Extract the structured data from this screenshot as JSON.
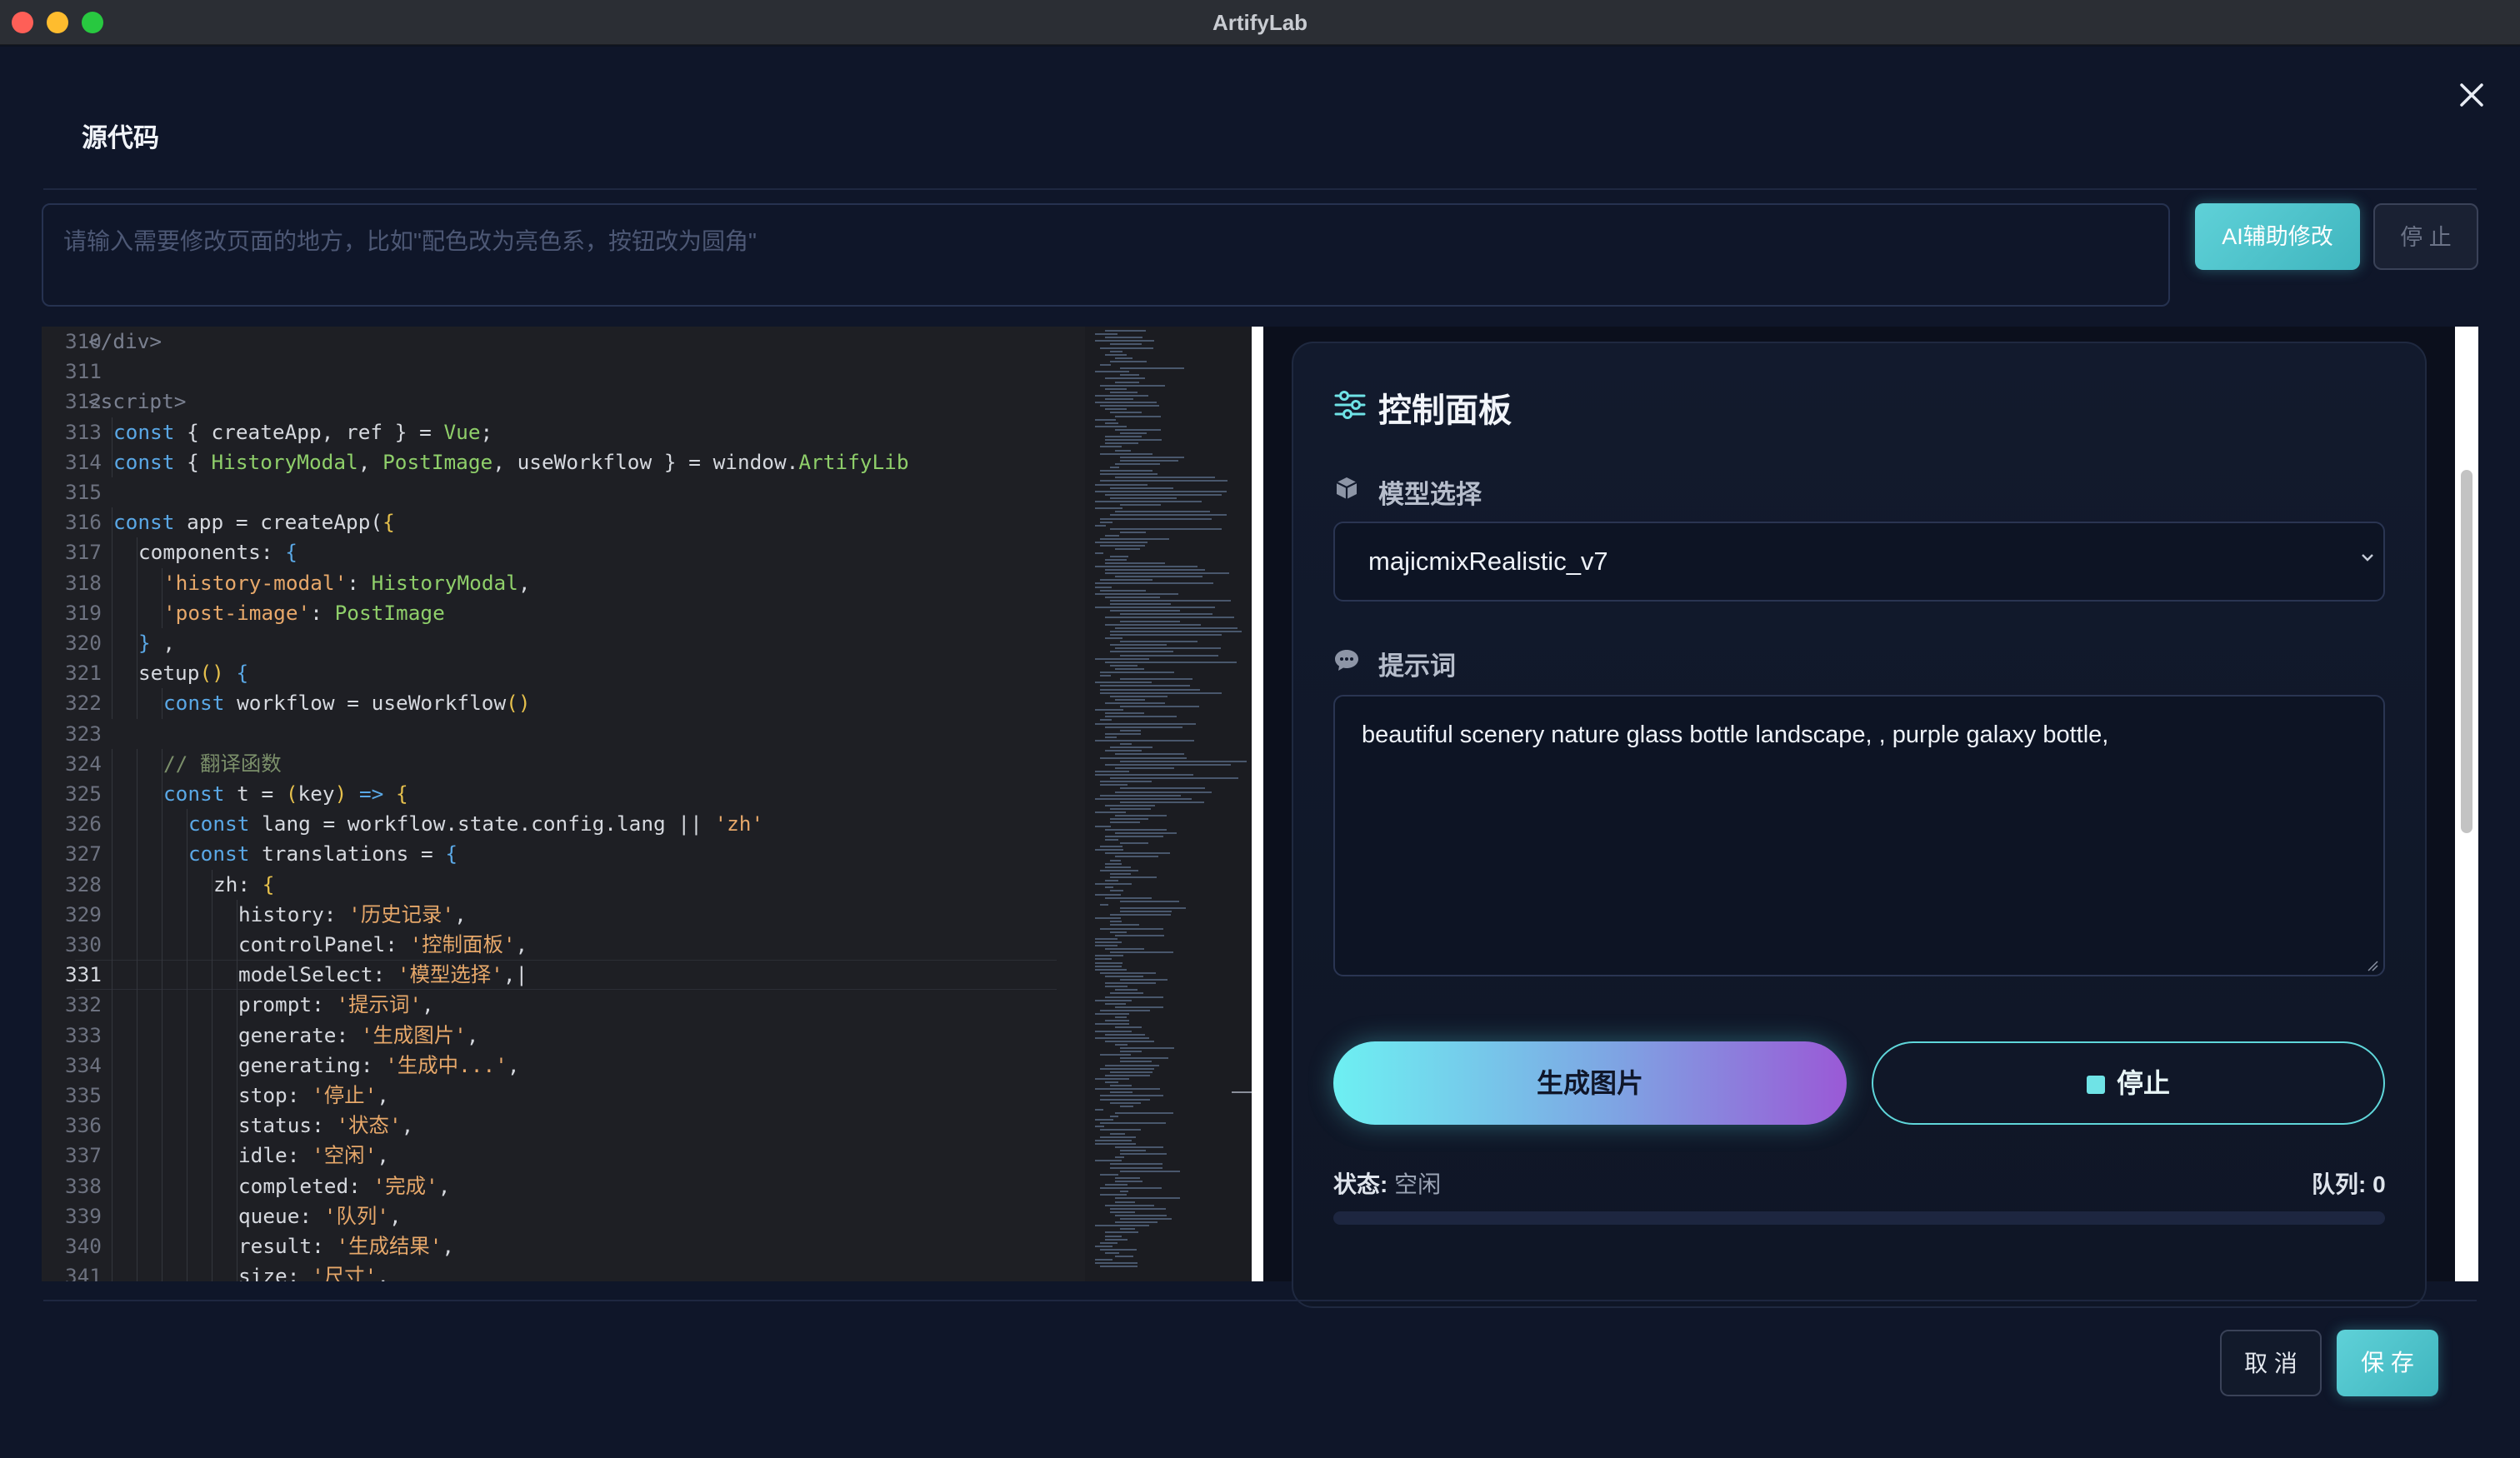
{
  "window": {
    "title": "ArtifyLab"
  },
  "modal": {
    "title": "源代码",
    "ai_input_placeholder": "请输入需要修改页面的地方，比如\"配色改为亮色系，按钮改为圆角\"",
    "ai_button": "AI辅助修改",
    "stop_button": "停 止",
    "cancel_button": "取 消",
    "save_button": "保 存"
  },
  "editor": {
    "current_line": 331,
    "lines": [
      {
        "n": "310",
        "indent": 0
      },
      {
        "n": "311",
        "indent": 0
      },
      {
        "n": "312",
        "indent": 0
      },
      {
        "n": "313",
        "indent": 1
      },
      {
        "n": "314",
        "indent": 1
      },
      {
        "n": "315",
        "indent": 0
      },
      {
        "n": "316",
        "indent": 1
      },
      {
        "n": "317",
        "indent": 2
      },
      {
        "n": "318",
        "indent": 3
      },
      {
        "n": "319",
        "indent": 3
      },
      {
        "n": "320",
        "indent": 2
      },
      {
        "n": "321",
        "indent": 2
      },
      {
        "n": "322",
        "indent": 3
      },
      {
        "n": "323",
        "indent": 0
      },
      {
        "n": "324",
        "indent": 3
      },
      {
        "n": "325",
        "indent": 3
      },
      {
        "n": "326",
        "indent": 4
      },
      {
        "n": "327",
        "indent": 4
      },
      {
        "n": "328",
        "indent": 5
      },
      {
        "n": "329",
        "indent": 6
      },
      {
        "n": "330",
        "indent": 6
      },
      {
        "n": "331",
        "indent": 6
      },
      {
        "n": "332",
        "indent": 6
      },
      {
        "n": "333",
        "indent": 6
      },
      {
        "n": "334",
        "indent": 6
      },
      {
        "n": "335",
        "indent": 6
      },
      {
        "n": "336",
        "indent": 6
      },
      {
        "n": "337",
        "indent": 6
      },
      {
        "n": "338",
        "indent": 6
      },
      {
        "n": "339",
        "indent": 6
      },
      {
        "n": "340",
        "indent": 6
      },
      {
        "n": "341",
        "indent": 6
      }
    ],
    "code": [
      [
        [
          "tag",
          "</div>"
        ]
      ],
      [],
      [
        [
          "tag",
          "<script>"
        ]
      ],
      [
        [
          "k",
          "const"
        ],
        [
          "",
          "{ createApp, ref } = "
        ],
        [
          "t",
          "Vue"
        ],
        [
          "",
          ";"
        ]
      ],
      [
        [
          "k",
          "const"
        ],
        [
          "",
          "{ "
        ],
        [
          "t",
          "HistoryModal"
        ],
        [
          "",
          ", "
        ],
        [
          "t",
          "PostImage"
        ],
        [
          "",
          ", useWorkflow } = window."
        ],
        [
          "t",
          "ArtifyLib"
        ]
      ],
      [],
      [
        [
          "k",
          "const"
        ],
        [
          "",
          "app = createApp("
        ],
        [
          "p",
          "{"
        ]
      ],
      [
        [
          "",
          "components: "
        ],
        [
          "k",
          "{"
        ]
      ],
      [
        [
          "s",
          "'history-modal'"
        ],
        [
          "",
          ": "
        ],
        [
          "t",
          "HistoryModal"
        ],
        [
          "",
          ","
        ]
      ],
      [
        [
          "s",
          "'post-image'"
        ],
        [
          "",
          ": "
        ],
        [
          "t",
          "PostImage"
        ]
      ],
      [
        [
          "k",
          "}"
        ],
        [
          "",
          ","
        ]
      ],
      [
        [
          "",
          "setup"
        ],
        [
          "p",
          "()"
        ],
        [
          "",
          ""
        ],
        [
          "k",
          " {"
        ]
      ],
      [
        [
          "k",
          "const"
        ],
        [
          "",
          "workflow = useWorkflow"
        ],
        [
          "p",
          "()"
        ]
      ],
      [],
      [
        [
          "c",
          "// 翻译函数"
        ]
      ],
      [
        [
          "k",
          "const"
        ],
        [
          "",
          "t = "
        ],
        [
          "p",
          "("
        ],
        [
          "",
          "key"
        ],
        [
          "p",
          ")"
        ],
        [
          "k",
          " =>"
        ],
        [
          "p",
          " {"
        ]
      ],
      [
        [
          "k",
          "const"
        ],
        [
          "",
          "lang = workflow.state.config.lang || "
        ],
        [
          "s",
          "'zh'"
        ]
      ],
      [
        [
          "k",
          "const"
        ],
        [
          "",
          "translations = "
        ],
        [
          "k",
          "{"
        ]
      ],
      [
        [
          "",
          "zh: "
        ],
        [
          "p",
          "{"
        ]
      ],
      [
        [
          "",
          "history: "
        ],
        [
          "s",
          "'历史记录'"
        ],
        [
          "",
          ","
        ]
      ],
      [
        [
          "",
          "controlPanel: "
        ],
        [
          "s",
          "'控制面板'"
        ],
        [
          "",
          ","
        ]
      ],
      [
        [
          "",
          "modelSelect: "
        ],
        [
          "s",
          "'模型选择'"
        ],
        [
          "",
          ",|"
        ]
      ],
      [
        [
          "",
          "prompt: "
        ],
        [
          "s",
          "'提示词'"
        ],
        [
          "",
          ","
        ]
      ],
      [
        [
          "",
          "generate: "
        ],
        [
          "s",
          "'生成图片'"
        ],
        [
          "",
          ","
        ]
      ],
      [
        [
          "",
          "generating: "
        ],
        [
          "s",
          "'生成中...'"
        ],
        [
          "",
          ","
        ]
      ],
      [
        [
          "",
          "stop: "
        ],
        [
          "s",
          "'停止'"
        ],
        [
          "",
          ","
        ]
      ],
      [
        [
          "",
          "status: "
        ],
        [
          "s",
          "'状态'"
        ],
        [
          "",
          ","
        ]
      ],
      [
        [
          "",
          "idle: "
        ],
        [
          "s",
          "'空闲'"
        ],
        [
          "",
          ","
        ]
      ],
      [
        [
          "",
          "completed: "
        ],
        [
          "s",
          "'完成'"
        ],
        [
          "",
          ","
        ]
      ],
      [
        [
          "",
          "queue: "
        ],
        [
          "s",
          "'队列'"
        ],
        [
          "",
          ","
        ]
      ],
      [
        [
          "",
          "result: "
        ],
        [
          "s",
          "'生成结果'"
        ],
        [
          "",
          ","
        ]
      ],
      [
        [
          "",
          "size: "
        ],
        [
          "s",
          "'尺寸'"
        ],
        [
          "",
          ","
        ]
      ]
    ]
  },
  "preview": {
    "panel_title": "控制面板",
    "model_label": "模型选择",
    "model_value": "majicmixRealistic_v7",
    "prompt_label": "提示词",
    "prompt_value": "beautiful scenery nature glass bottle landscape, , purple galaxy bottle,",
    "generate_button": "生成图片",
    "stop_button": "停止",
    "status_label": "状态:",
    "status_value": "空闲",
    "queue_text": "队列: 0",
    "progress": 0
  },
  "icons": {
    "close": "close-icon",
    "panel": "sliders-icon",
    "model": "cube-icon",
    "prompt": "chat-bubble-icon",
    "select": "chevron-down-icon"
  },
  "colors": {
    "accent": "#5fd1d8",
    "gradient_end": "#9a59d6",
    "background": "#0f1629"
  }
}
